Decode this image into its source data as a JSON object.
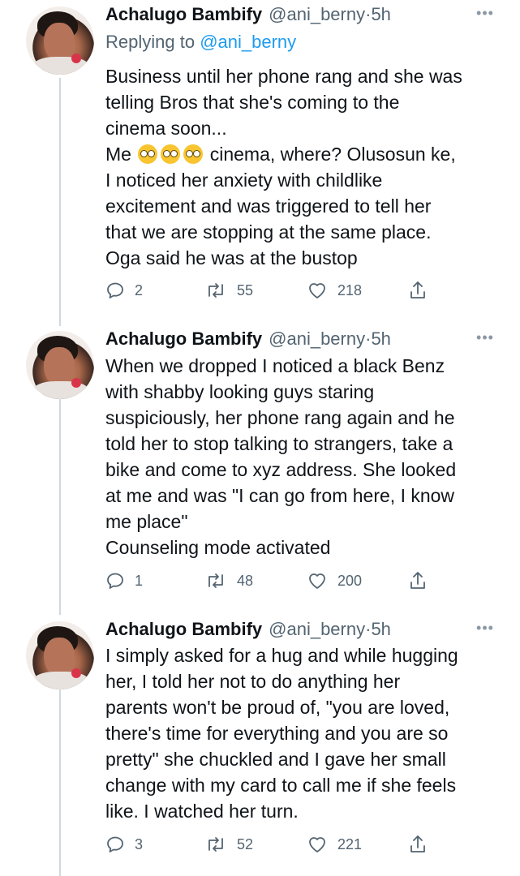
{
  "tweets": [
    {
      "name": "Achalugo Bambify",
      "handle": "@ani_berny",
      "separator": "·",
      "time": "5h",
      "replying_prefix": "Replying to ",
      "replying_to": "@ani_berny",
      "lines": [
        "Business until her phone rang and she was",
        "telling Bros that she's coming to the",
        "cinema soon...",
        "Me",
        "I noticed her anxiety with childlike",
        "excitement and was triggered to tell her",
        "that we are stopping at the same place.",
        "Oga said he was at the bustop"
      ],
      "me_line_rest": " cinema, where? Olusosun ke,",
      "replies": "2",
      "retweets": "55",
      "likes": "218"
    },
    {
      "name": "Achalugo Bambify",
      "handle": "@ani_berny",
      "separator": "·",
      "time": "5h",
      "lines": [
        "When we dropped I noticed a black Benz",
        "with shabby looking guys staring",
        "suspiciously, her phone rang again and he",
        "told her to stop talking to strangers, take a",
        "bike and come to xyz address. She looked",
        "at me and was \"I can go from here, I know",
        "me place\"",
        "Counseling mode activated"
      ],
      "replies": "1",
      "retweets": "48",
      "likes": "200"
    },
    {
      "name": "Achalugo Bambify",
      "handle": "@ani_berny",
      "separator": "·",
      "time": "5h",
      "lines": [
        "I simply asked for a hug and while hugging",
        "her, I told her not to do anything her",
        "parents won't be proud of, \"you are loved,",
        "there's time for everything and you are so",
        "pretty\" she chuckled and I gave her small",
        "change with my card to call me if she feels",
        "like. I watched her turn."
      ],
      "replies": "3",
      "retweets": "52",
      "likes": "221"
    }
  ],
  "icons": {
    "reply": "reply-icon",
    "retweet": "retweet-icon",
    "like": "heart-icon",
    "share": "share-icon",
    "more": "more-icon",
    "emoji": "face-with-monocle-emoji"
  },
  "colors": {
    "text": "#0f1419",
    "secondary": "#536471",
    "link": "#1d9bf0",
    "thread_line": "#cfd9de",
    "emoji": "#f8c531"
  }
}
